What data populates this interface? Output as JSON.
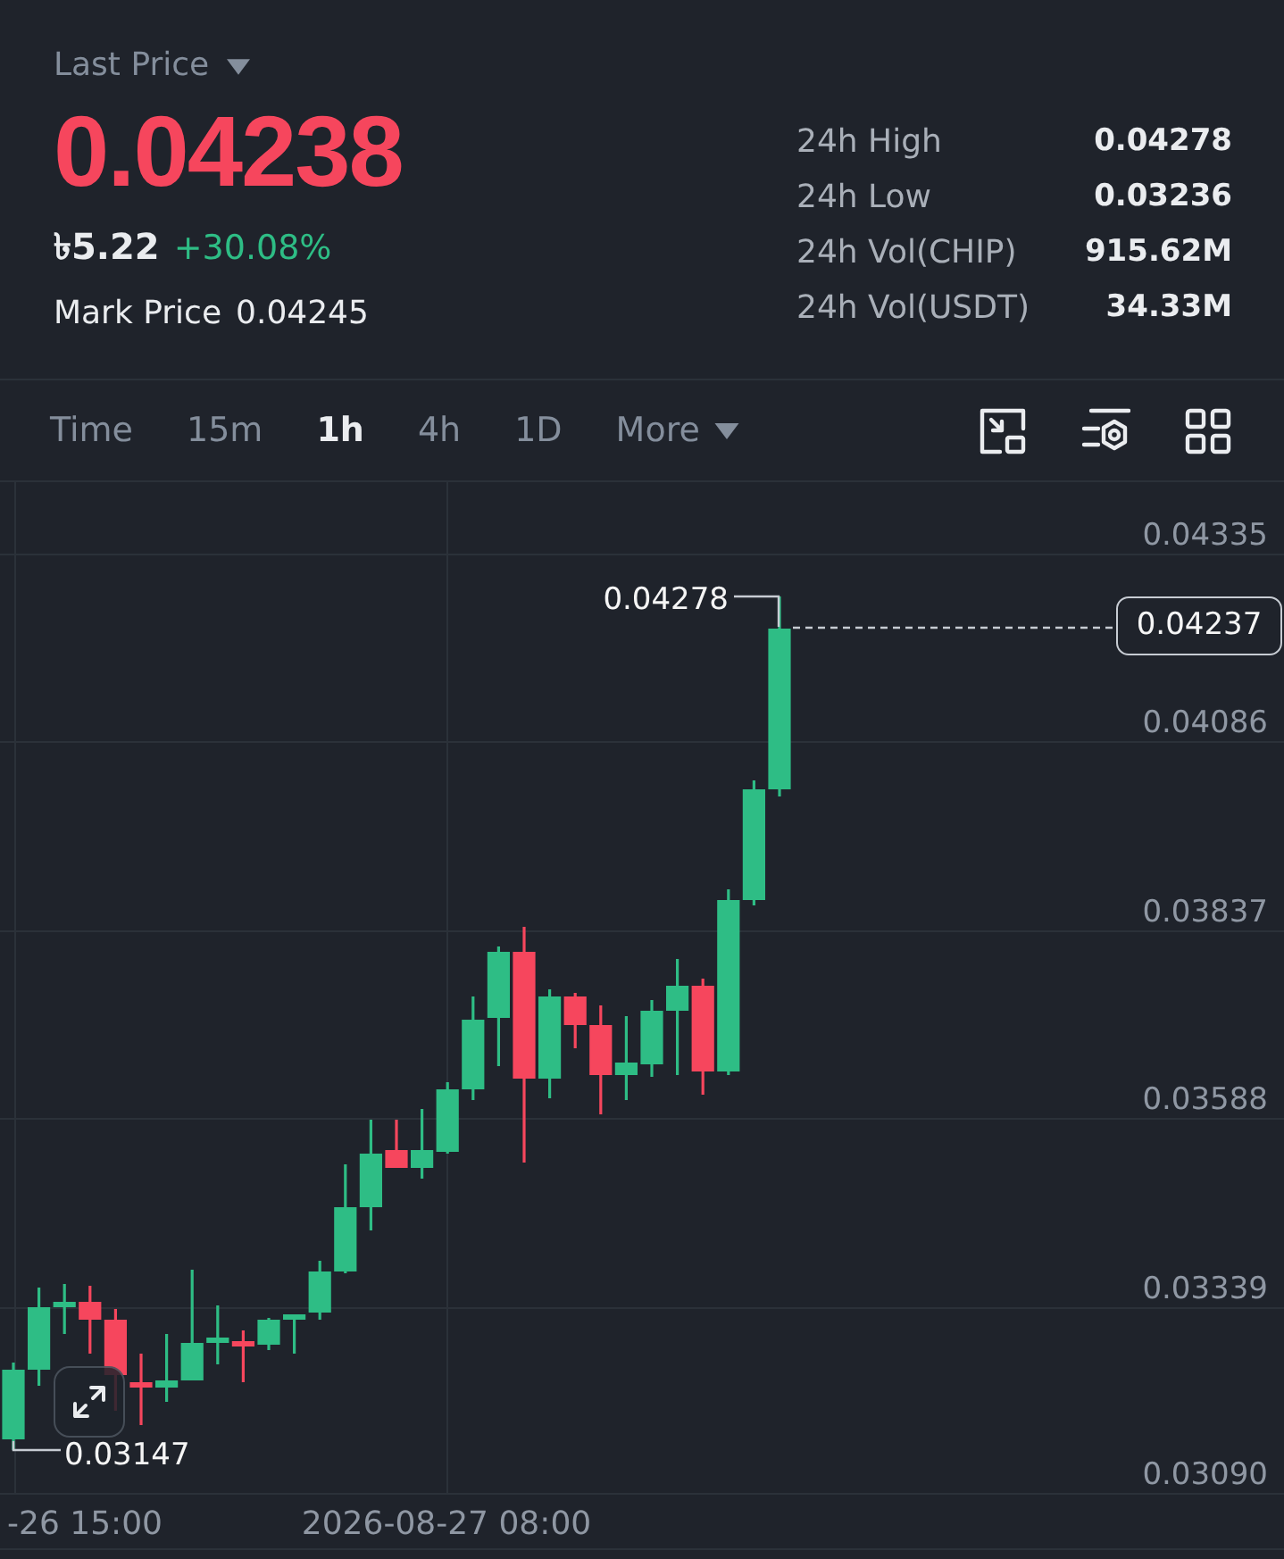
{
  "header": {
    "price_type": {
      "label": "Last Price"
    },
    "last_price": {
      "value": "0.04238",
      "rising": false
    },
    "fiat_price": "৳5.22",
    "change": {
      "value": "+30.08%",
      "rising": true
    },
    "mark_price": {
      "label": "Mark Price",
      "value": "0.04245"
    },
    "stats": [
      {
        "label": "24h High",
        "value": "0.04278"
      },
      {
        "label": "24h Low",
        "value": "0.03236"
      },
      {
        "label": "24h Vol(CHIP)",
        "value": "915.62M"
      },
      {
        "label": "24h Vol(USDT)",
        "value": "34.33M"
      }
    ]
  },
  "interval_bar": {
    "intervals": [
      {
        "label": "Time",
        "kind": "interval",
        "selected": false
      },
      {
        "label": "15m",
        "kind": "interval",
        "selected": false
      },
      {
        "label": "1h",
        "kind": "interval",
        "selected": true
      },
      {
        "label": "4h",
        "kind": "interval",
        "selected": false
      },
      {
        "label": "1D",
        "kind": "interval",
        "selected": false
      },
      {
        "label": "More",
        "kind": "menu",
        "selected": false
      }
    ]
  },
  "chart": {
    "price_axis": [
      "0.04335",
      "0.04086",
      "0.03837",
      "0.03588",
      "0.03339",
      "0.03090"
    ],
    "time_axis": [
      "-26 15:00",
      "2026-08-27 08:00"
    ],
    "high_marker": "0.04278",
    "low_marker": "0.03147",
    "current_price": "0.04237"
  }
}
